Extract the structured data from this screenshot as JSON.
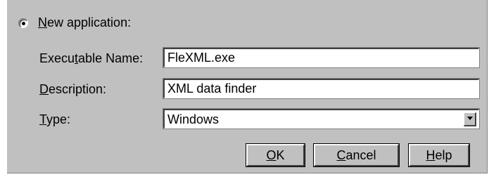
{
  "radio": {
    "label_mnemonic": "N",
    "label_rest": "ew application:",
    "selected": true
  },
  "fields": {
    "executable": {
      "label_pre": "Execu",
      "label_mnemonic": "t",
      "label_post": "able Name:",
      "value": "FleXML.exe"
    },
    "description": {
      "label_mnemonic": "D",
      "label_rest": "escription:",
      "value": "XML data finder"
    },
    "type": {
      "label_mnemonic": "T",
      "label_rest": "ype:",
      "value": "Windows"
    }
  },
  "buttons": {
    "ok": {
      "mnemonic": "O",
      "rest": "K"
    },
    "cancel": {
      "mnemonic": "C",
      "rest": "ancel"
    },
    "help": {
      "mnemonic": "H",
      "rest": "elp"
    }
  },
  "icons": {
    "dropdown": "chevron-down-icon",
    "radio": "radio-selected-icon"
  },
  "colors": {
    "face": "#c0c0c0",
    "field_bg": "#ffffff",
    "text": "#000000"
  }
}
